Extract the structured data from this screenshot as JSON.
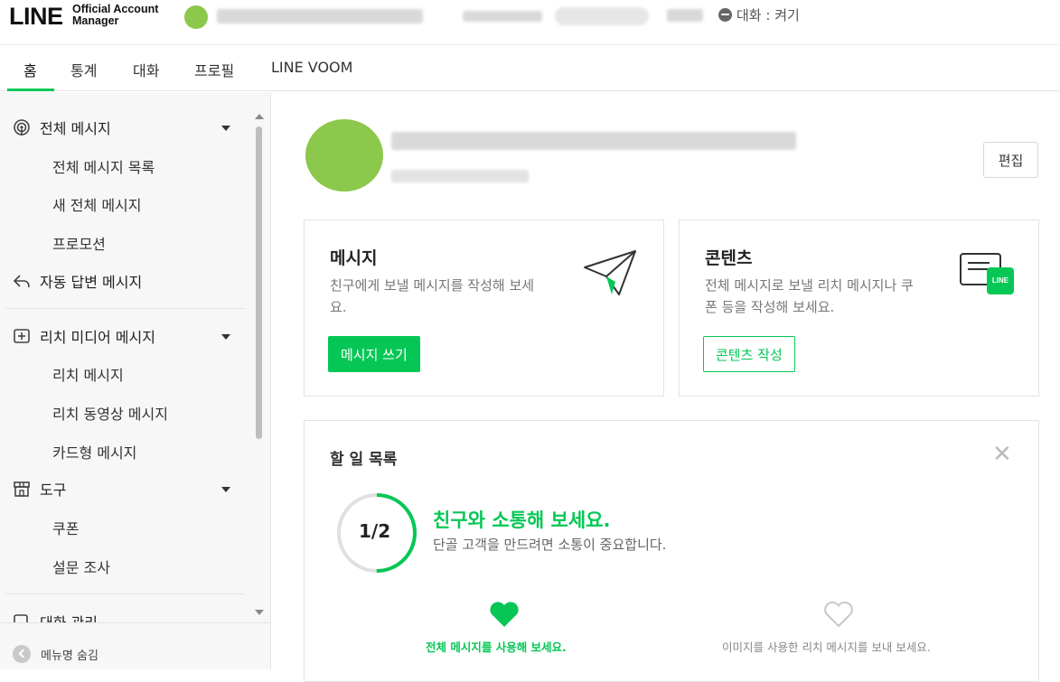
{
  "header": {
    "logo_main": "LINE",
    "logo_sub_line1": "Official Account",
    "logo_sub_line2": "Manager",
    "chat_status": "대화 : 켜기"
  },
  "tabs": [
    {
      "label": "홈",
      "active": true
    },
    {
      "label": "통계"
    },
    {
      "label": "대화"
    },
    {
      "label": "프로필"
    },
    {
      "label": "LINE VOOM"
    }
  ],
  "sidebar": {
    "groups": [
      {
        "label": "전체 메시지",
        "icon": "broadcast-icon",
        "items": [
          "전체 메시지 목록",
          "새 전체 메시지",
          "프로모션"
        ]
      },
      {
        "label": "자동 답변 메시지",
        "icon": "reply-icon",
        "items": []
      },
      {
        "label": "리치 미디어 메시지",
        "icon": "add-box-icon",
        "items": [
          "리치 메시지",
          "리치 동영상 메시지",
          "카드형 메시지"
        ]
      },
      {
        "label": "도구",
        "icon": "store-icon",
        "items": [
          "쿠폰",
          "설문 조사"
        ]
      },
      {
        "label": "대화 관리",
        "icon": "chat-manage-icon",
        "items": []
      }
    ],
    "footer_label": "메뉴명 숨김"
  },
  "main": {
    "edit_label": "편집",
    "message_card": {
      "title": "메시지",
      "desc_line1": "친구에게 보낼 메시지를 작성해 보세",
      "desc_line2": "요.",
      "button": "메시지 쓰기"
    },
    "content_card": {
      "title": "콘텐츠",
      "desc_line1": "전체 메시지로 보낼 리치 메시지나 쿠",
      "desc_line2": "폰 등을 작성해 보세요.",
      "button": "콘텐츠 작성",
      "badge": "LINE"
    },
    "todo": {
      "title": "할 일 목록",
      "progress_label": "1/2",
      "progress_fraction": 0.5,
      "heading": "친구와 소통해 보세요.",
      "subtitle": "단골 고객을 만드려면 소통이 중요합니다.",
      "tasks": [
        {
          "label": "전체 메시지를 사용해 보세요.",
          "done": true
        },
        {
          "label": "이미지를 사용한 리치 메시지를 보내 보세요.",
          "done": false
        }
      ]
    }
  },
  "colors": {
    "accent": "#06c755",
    "avatar": "#8cc84b"
  }
}
